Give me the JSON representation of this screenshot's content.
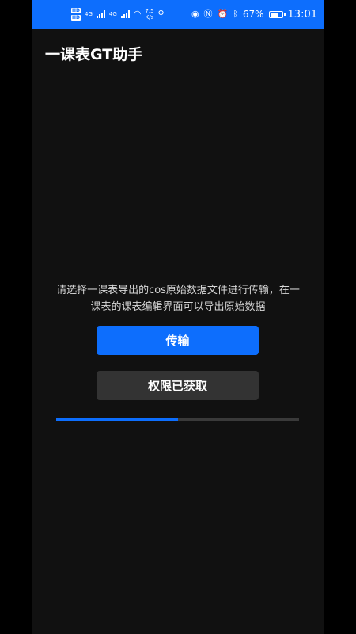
{
  "status_bar": {
    "hd_top": "HD",
    "hd_bottom": "HD",
    "net_top": "4G",
    "net_bottom": "4G",
    "speed_value": "7.5",
    "speed_unit": "K/s",
    "battery": "67%",
    "time": "13:01"
  },
  "app": {
    "title": "一课表GT助手"
  },
  "main": {
    "description": "请选择一课表导出的cos原始数据文件进行传输，在一课表的课表编辑界面可以导出原始数据",
    "transfer_button": "传输",
    "permission_button": "权限已获取",
    "progress": 0.5
  },
  "colors": {
    "accent": "#0d6efd",
    "background": "#111111",
    "secondary_button": "#333333"
  }
}
